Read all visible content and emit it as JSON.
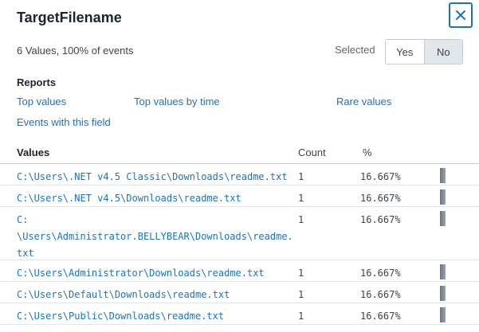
{
  "panel": {
    "title": "TargetFilename",
    "summary": "6 Values, 100% of events",
    "selected_label": "Selected",
    "toggle_yes": "Yes",
    "toggle_no": "No",
    "selected_value": "No"
  },
  "reports": {
    "heading": "Reports",
    "top_values": "Top values",
    "top_values_by_time": "Top values by time",
    "rare_values": "Rare values",
    "events_with_field": "Events with this field"
  },
  "table": {
    "headers": {
      "values": "Values",
      "count": "Count",
      "percent": "%"
    },
    "rows": [
      {
        "value": "C:\\Users\\.NET v4.5 Classic\\Downloads\\readme.txt",
        "count": "1",
        "percent": "16.667%",
        "share": 16.667
      },
      {
        "value": "C:\\Users\\.NET v4.5\\Downloads\\readme.txt",
        "count": "1",
        "percent": "16.667%",
        "share": 16.667
      },
      {
        "value": "C:\\Users\\Administrator.BELLYBEAR\\Downloads\\readme.txt",
        "count": "1",
        "percent": "16.667%",
        "share": 16.667
      },
      {
        "value": "C:\\Users\\Administrator\\Downloads\\readme.txt",
        "count": "1",
        "percent": "16.667%",
        "share": 16.667
      },
      {
        "value": "C:\\Users\\Default\\Downloads\\readme.txt",
        "count": "1",
        "percent": "16.667%",
        "share": 16.667
      },
      {
        "value": "C:\\Users\\Public\\Downloads\\readme.txt",
        "count": "1",
        "percent": "16.667%",
        "share": 16.667
      }
    ]
  },
  "colors": {
    "link": "#1a73bf",
    "bar": "#7a838d",
    "toggle_active": "#e1e6eb"
  },
  "icons": {
    "close": "close-icon"
  }
}
